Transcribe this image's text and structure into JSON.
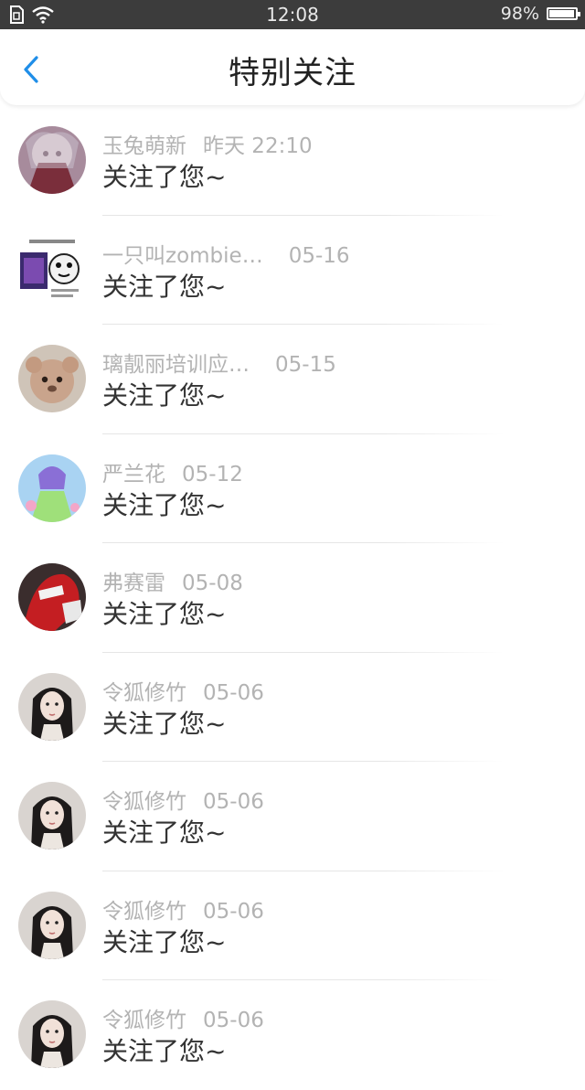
{
  "status_bar": {
    "time": "12:08",
    "battery": "98%",
    "battery_level": 0.98
  },
  "header": {
    "title": "特别关注"
  },
  "items": [
    {
      "name": "玉兔萌新",
      "time": "昨天 22:10",
      "message": "关注了您~"
    },
    {
      "name": "一只叫zombie…",
      "time": "05-16",
      "message": "关注了您~"
    },
    {
      "name": "璃靓丽培训应…",
      "time": "05-15",
      "message": "关注了您~"
    },
    {
      "name": "严兰花",
      "time": "05-12",
      "message": "关注了您~"
    },
    {
      "name": "弗赛雷",
      "time": "05-08",
      "message": "关注了您~"
    },
    {
      "name": "令狐修竹",
      "time": "05-06",
      "message": "关注了您~"
    },
    {
      "name": "令狐修竹",
      "time": "05-06",
      "message": "关注了您~"
    },
    {
      "name": "令狐修竹",
      "time": "05-06",
      "message": "关注了您~"
    },
    {
      "name": "令狐修竹",
      "time": "05-06",
      "message": "关注了您~"
    }
  ]
}
